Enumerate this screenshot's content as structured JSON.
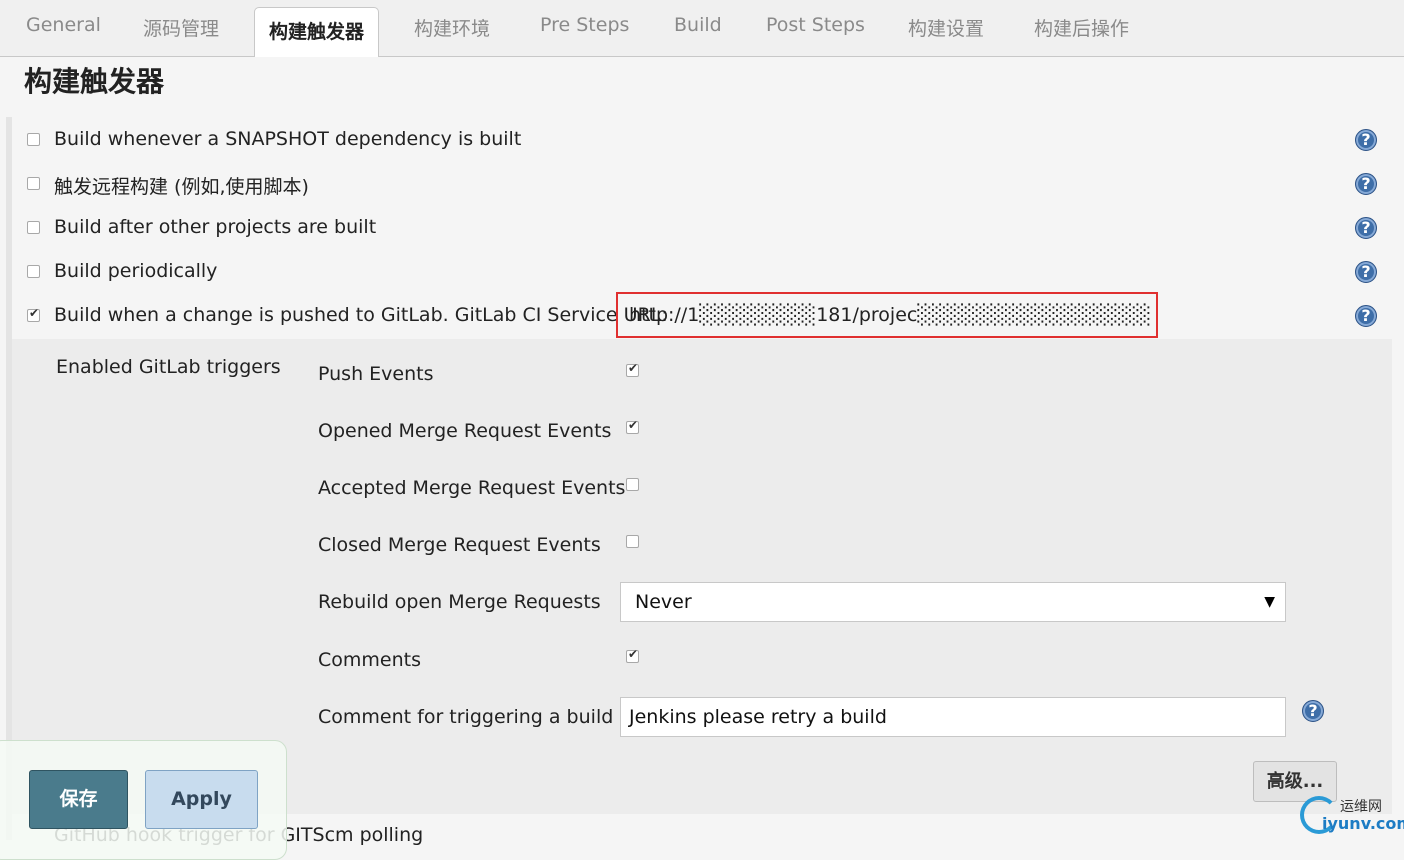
{
  "tabs": [
    {
      "label": "General"
    },
    {
      "label": "源码管理"
    },
    {
      "label": "构建触发器",
      "active": true
    },
    {
      "label": "构建环境"
    },
    {
      "label": "Pre Steps"
    },
    {
      "label": "Build"
    },
    {
      "label": "Post Steps"
    },
    {
      "label": "构建设置"
    },
    {
      "label": "构建后操作"
    }
  ],
  "section_title": "构建触发器",
  "triggers": [
    {
      "label": "Build whenever a SNAPSHOT dependency is built",
      "checked": false
    },
    {
      "label": "触发远程构建 (例如,使用脚本)",
      "checked": false
    },
    {
      "label": "Build after other projects are built",
      "checked": false
    },
    {
      "label": "Build periodically",
      "checked": false
    },
    {
      "label": "Build when a change is pushed to GitLab. GitLab CI Service URL:",
      "checked": true,
      "url_visible": "http://1░░░░░░░░181/projec░░░░░░░░░░░░░░░░"
    }
  ],
  "gitlab": {
    "enabled_label": "Enabled GitLab triggers",
    "events": [
      {
        "label": "Push Events",
        "checked": true
      },
      {
        "label": "Opened Merge Request Events",
        "checked": true
      },
      {
        "label": "Accepted Merge Request Events",
        "checked": false
      },
      {
        "label": "Closed Merge Request Events",
        "checked": false
      }
    ],
    "rebuild_label": "Rebuild open Merge Requests",
    "rebuild_value": "Never",
    "comments_label": "Comments",
    "comments_checked": true,
    "comment_trigger_label": "Comment for triggering a build",
    "comment_trigger_value": "Jenkins please retry a build",
    "advanced_label": "高级..."
  },
  "cutoff_trigger_label": "GitHub hook trigger for GITScm polling",
  "buttons": {
    "save": "保存",
    "apply": "Apply"
  },
  "watermark": {
    "top": "运维网",
    "bottom": "iyunv.com"
  },
  "help_glyph": "?",
  "dropdown_arrow": "▼",
  "colors": {
    "help_icon": "#3e6ea8",
    "save_button": "#4a7b8c",
    "apply_button": "#c8dcee",
    "highlight_box": "#e03030"
  }
}
